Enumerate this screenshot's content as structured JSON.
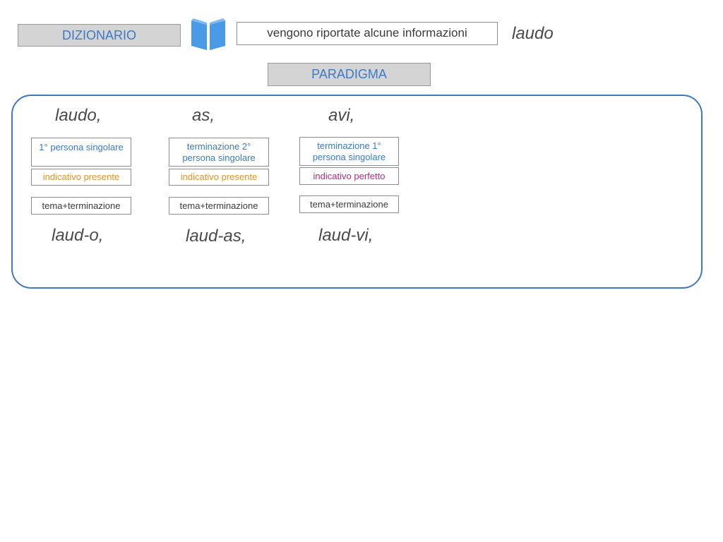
{
  "header": {
    "dictionary_label": "DIZIONARIO",
    "info_text": "vengono riportate alcune informazioni",
    "word": "laudo",
    "icon": "open-book-icon",
    "accent_color": "#3a7bc8"
  },
  "paradigm_label": "PARADIGMA",
  "columns": [
    {
      "form": "laudo,",
      "person": "1° persona singolare",
      "mood_tense": "indicativo presente",
      "analysis": "tema+terminazione",
      "split": "laud-o,"
    },
    {
      "form": "as,",
      "person": "terminazione 2° persona singolare",
      "mood_tense": "indicativo presente",
      "analysis": "tema+terminazione",
      "split": "laud-as,"
    },
    {
      "form": "avi,",
      "person": "terminazione 1° persona singolare",
      "mood_tense": "indicativo perfetto",
      "analysis": "tema+terminazione",
      "split": "laud-vi,"
    }
  ],
  "colors": {
    "person": "#3a7bc8",
    "present": "#e8931e",
    "perfect": "#c0267f",
    "panel_border": "#3f77c0"
  }
}
